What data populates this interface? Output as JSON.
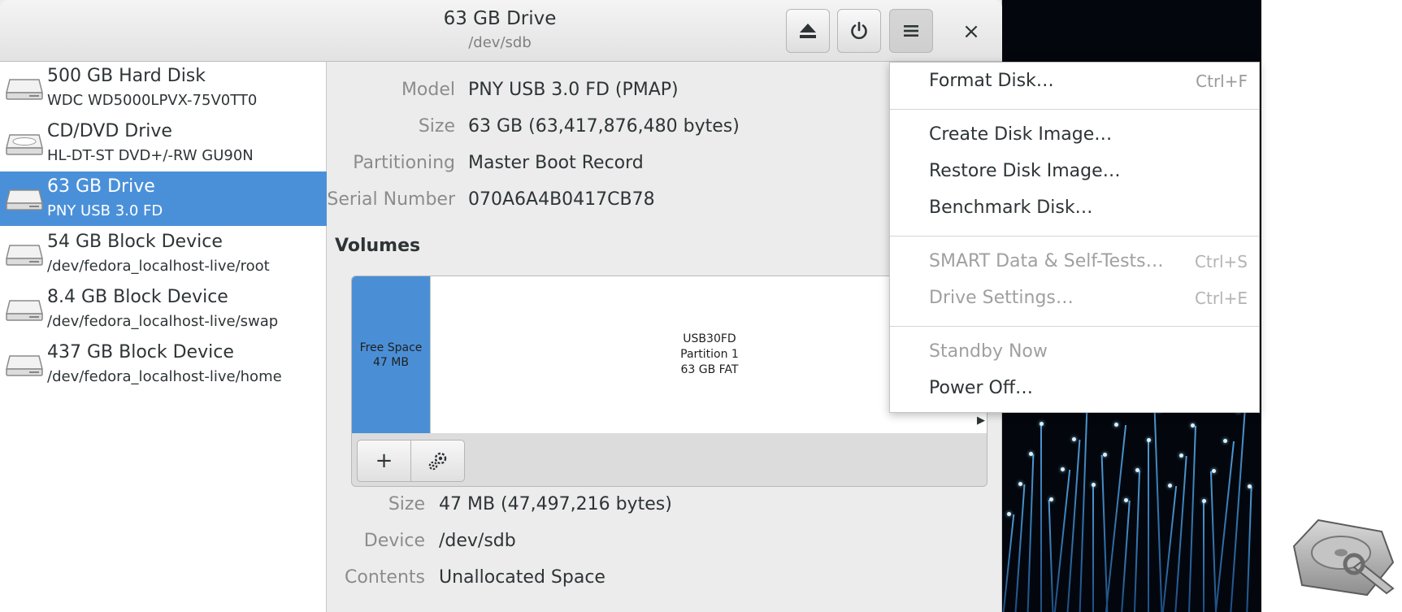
{
  "window": {
    "title": "63 GB Drive",
    "subtitle": "/dev/sdb",
    "close_label": "×"
  },
  "header_buttons": {
    "eject_icon": "eject-icon",
    "power_icon": "power-icon",
    "menu_icon": "hamburger-icon"
  },
  "sidebar": {
    "items": [
      {
        "name": "500 GB Hard Disk",
        "sub": "WDC WD5000LPVX-75V0TT0",
        "icon": "hard-disk-icon"
      },
      {
        "name": "CD/DVD Drive",
        "sub": "HL-DT-ST DVD+/-RW GU90N",
        "icon": "optical-drive-icon"
      },
      {
        "name": "63 GB Drive",
        "sub": "PNY USB 3.0 FD",
        "icon": "drive-icon",
        "selected": true
      },
      {
        "name": "54 GB Block Device",
        "sub": "/dev/fedora_localhost-live/root",
        "icon": "drive-icon"
      },
      {
        "name": "8.4 GB Block Device",
        "sub": "/dev/fedora_localhost-live/swap",
        "icon": "drive-icon"
      },
      {
        "name": "437 GB Block Device",
        "sub": "/dev/fedora_localhost-live/home",
        "icon": "drive-icon"
      }
    ]
  },
  "drive_props": [
    {
      "label": "Model",
      "value": "PNY USB 3.0 FD (PMAP)"
    },
    {
      "label": "Size",
      "value": "63 GB (63,417,876,480 bytes)"
    },
    {
      "label": "Partitioning",
      "value": "Master Boot Record"
    },
    {
      "label": "Serial Number",
      "value": "070A6A4B0417CB78"
    }
  ],
  "volumes": {
    "heading": "Volumes",
    "free_space": {
      "line1": "Free Space",
      "line2": "47 MB"
    },
    "partition": {
      "line1": "USB30FD",
      "line2": "Partition 1",
      "line3": "63 GB FAT"
    },
    "add_label": "+",
    "settings_icon": "gears-icon"
  },
  "volume_props": [
    {
      "label": "Size",
      "value": "47 MB (47,497,216 bytes)"
    },
    {
      "label": "Device",
      "value": "/dev/sdb"
    },
    {
      "label": "Contents",
      "value": "Unallocated Space"
    }
  ],
  "menu": {
    "items": [
      {
        "label": "Format Disk…",
        "accel": "Ctrl+F",
        "enabled": true
      },
      {
        "label": "Create Disk Image…",
        "accel": "",
        "enabled": true
      },
      {
        "label": "Restore Disk Image…",
        "accel": "",
        "enabled": true
      },
      {
        "label": "Benchmark Disk…",
        "accel": "",
        "enabled": true
      },
      {
        "label": "SMART Data & Self-Tests…",
        "accel": "Ctrl+S",
        "enabled": false
      },
      {
        "label": "Drive Settings…",
        "accel": "Ctrl+E",
        "enabled": false
      },
      {
        "label": "Standby Now",
        "accel": "",
        "enabled": false
      },
      {
        "label": "Power Off…",
        "accel": "",
        "enabled": true
      }
    ]
  },
  "colors": {
    "selection": "#4a90d9",
    "free_space": "#4a8fd6",
    "window_bg": "#ececec"
  }
}
